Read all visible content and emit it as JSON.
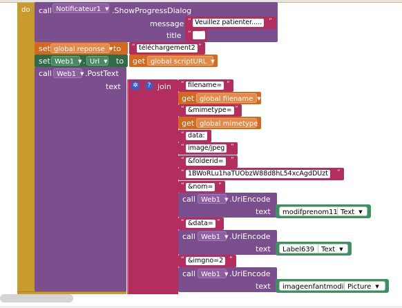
{
  "top": {
    "event_label": "do",
    "call_word": "call",
    "component": "Notificateur1",
    "method": ".ShowProgressDialog"
  },
  "progress": {
    "message_label": "message",
    "message_value": "Veuillez patienter.....",
    "title_label": "title",
    "title_value": ""
  },
  "set_reponse": {
    "set_word": "set",
    "var": "global reponse",
    "to_word": "to",
    "value": "téléchargement2"
  },
  "set_url": {
    "set_word": "set",
    "component": "Web1",
    "prop": "Url",
    "to_word": "to",
    "get_word": "get",
    "var": "global scriptURL"
  },
  "post": {
    "call_word": "call",
    "component": "Web1",
    "method": ".PostText",
    "text_label": "text",
    "join_word": "join"
  },
  "join_items": [
    {
      "kind": "str",
      "value": "filename="
    },
    {
      "kind": "get",
      "get_word": "get",
      "var": "global filename"
    },
    {
      "kind": "str",
      "value": "&mimetype="
    },
    {
      "kind": "get",
      "get_word": "get",
      "var": "global mimetype"
    },
    {
      "kind": "str",
      "value": "data:"
    },
    {
      "kind": "str",
      "value": "image/jpeg"
    },
    {
      "kind": "str",
      "value": "&folderid="
    },
    {
      "kind": "str",
      "value": "1BWoRLu1haTUObzW88d8hL54xcAgdDUzt"
    },
    {
      "kind": "str",
      "value": "&nom="
    },
    {
      "kind": "call",
      "call_word": "call",
      "component": "Web1",
      "method": ".UriEncode",
      "text_label": "text",
      "arg_component": "modifprenom11",
      "arg_prop": "Text"
    },
    {
      "kind": "str",
      "value": "&data="
    },
    {
      "kind": "call",
      "call_word": "call",
      "component": "Web1",
      "method": ".UriEncode",
      "text_label": "text",
      "arg_component": "Label639",
      "arg_prop": "Text"
    },
    {
      "kind": "str",
      "value": "&imgno=2"
    },
    {
      "kind": "call",
      "call_word": "call",
      "component": "Web1",
      "method": ".UriEncode",
      "text_label": "text",
      "arg_component": "imageenfantmodif",
      "arg_prop": "Picture"
    }
  ],
  "icons": {
    "mutator": "gear-icon",
    "help": "question-icon"
  },
  "colors": {
    "event": "#c99a2e",
    "component": "#7b4f8e",
    "text": "#b32d5e",
    "variable": "#d2691e",
    "component_set": "#2f6b47",
    "getter": "#3c9160"
  }
}
